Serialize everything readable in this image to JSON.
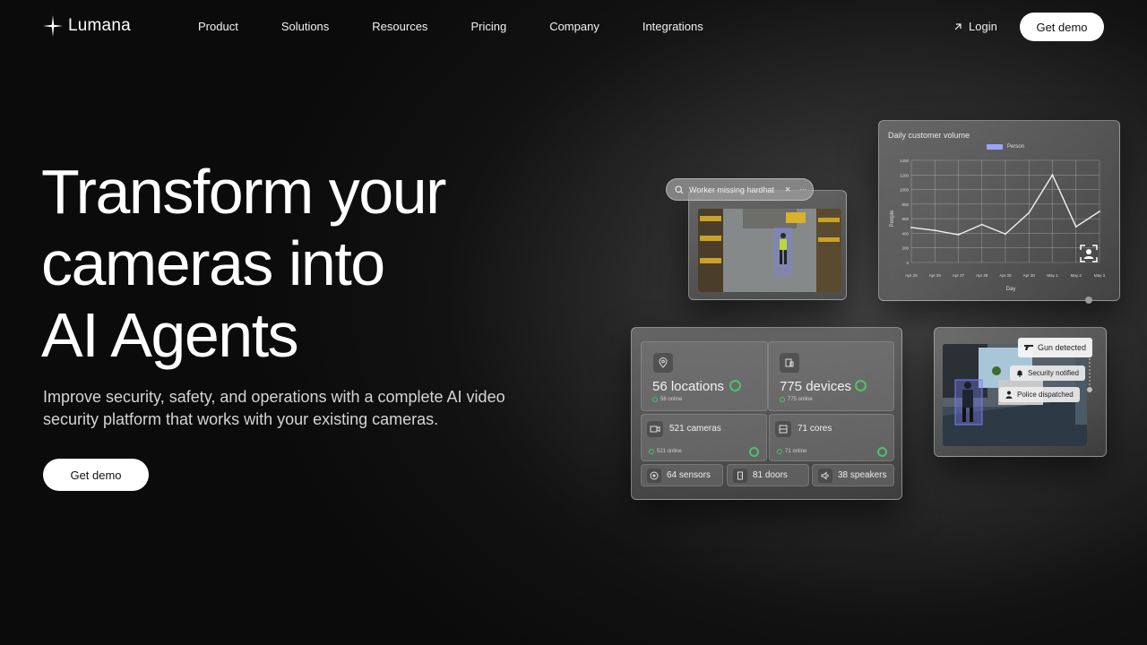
{
  "brand": {
    "name": "Lumana"
  },
  "nav": {
    "links": [
      "Product",
      "Solutions",
      "Resources",
      "Pricing",
      "Company",
      "Integrations"
    ],
    "login": "Login",
    "cta": "Get demo"
  },
  "hero": {
    "title_lines": [
      "Transform your",
      "cameras into",
      "AI Agents"
    ],
    "subtitle_lines": [
      "Improve security, safety, and operations with a complete AI video",
      "security platform that works with your existing cameras."
    ],
    "cta": "Get demo"
  },
  "search": {
    "query": "Worker missing hardhat"
  },
  "chart_data": {
    "type": "line",
    "title": "Daily customer volume",
    "legend": [
      "Person"
    ],
    "xlabel": "Day",
    "ylabel": "People",
    "categories": [
      "Apr 25",
      "Apr 26",
      "Apr 27",
      "Apr 28",
      "Apr 29",
      "Apr 30",
      "May 1",
      "May 2",
      "May 3"
    ],
    "yticks": [
      0,
      200,
      400,
      600,
      800,
      1000,
      1200,
      1400
    ],
    "ylim": [
      0,
      1400
    ],
    "series": [
      {
        "name": "Person",
        "values": [
          480,
          440,
          380,
          520,
          390,
          680,
          1200,
          490,
          700
        ]
      }
    ],
    "grid": true,
    "colors": {
      "line": "#f0f0f0",
      "legend": "#9aa3ff"
    }
  },
  "stats": {
    "locations": {
      "label": "56 locations",
      "online": "56 online"
    },
    "devices": {
      "label": "775 devices",
      "online": "775 online"
    },
    "cameras": {
      "label": "521 cameras",
      "online": "521 online"
    },
    "cores": {
      "label": "71 cores",
      "online": "71 online"
    },
    "sensors": "64 sensors",
    "doors": "81 doors",
    "speakers": "38 speakers"
  },
  "alerts": {
    "gun": "Gun detected",
    "security": "Security notified",
    "police": "Police dispatched"
  },
  "colors": {
    "status_green": "#4cc26a",
    "background": "#0b0b0b"
  }
}
